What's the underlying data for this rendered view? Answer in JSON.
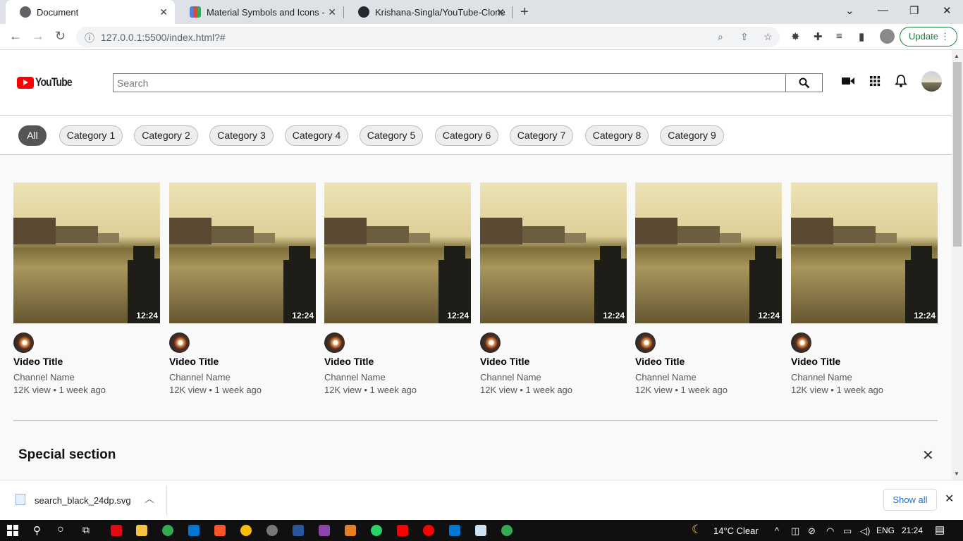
{
  "browser": {
    "tabs": [
      {
        "title": "Document",
        "icon": "globe-icon",
        "active": true
      },
      {
        "title": "Material Symbols and Icons - Goo",
        "icon": "google-fonts-icon",
        "active": false
      },
      {
        "title": "Krishana-Singla/YouTube-Clone",
        "icon": "github-icon",
        "active": false
      }
    ],
    "new_tab": "+",
    "url": "127.0.0.1:5500/index.html?#",
    "update_label": "Update"
  },
  "header": {
    "logo_text": "YouTube",
    "search_placeholder": "Search"
  },
  "categories": [
    "All",
    "Category 1",
    "Category 2",
    "Category 3",
    "Category 4",
    "Category 5",
    "Category 6",
    "Category 7",
    "Category 8",
    "Category 9"
  ],
  "videos": [
    {
      "title": "Video Title",
      "channel": "Channel Name",
      "meta": "12K view • 1 week ago",
      "duration": "12:24"
    },
    {
      "title": "Video Title",
      "channel": "Channel Name",
      "meta": "12K view • 1 week ago",
      "duration": "12:24"
    },
    {
      "title": "Video Title",
      "channel": "Channel Name",
      "meta": "12K view • 1 week ago",
      "duration": "12:24"
    },
    {
      "title": "Video Title",
      "channel": "Channel Name",
      "meta": "12K view • 1 week ago",
      "duration": "12:24"
    },
    {
      "title": "Video Title",
      "channel": "Channel Name",
      "meta": "12K view • 1 week ago",
      "duration": "12:24"
    },
    {
      "title": "Video Title",
      "channel": "Channel Name",
      "meta": "12K view • 1 week ago",
      "duration": "12:24"
    }
  ],
  "special": {
    "title": "Special section",
    "close": "✕"
  },
  "downloads": {
    "file": "search_black_24dp.svg",
    "show_all": "Show all"
  },
  "taskbar": {
    "weather": "14°C  Clear",
    "lang": "ENG",
    "time": "21:24"
  }
}
